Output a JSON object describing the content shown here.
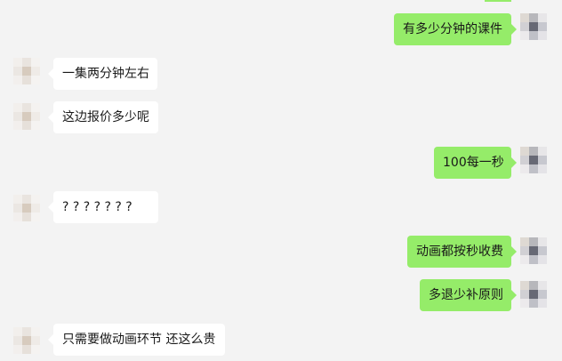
{
  "chat": {
    "messages": [
      {
        "side": "outgoing",
        "text": "有多少分钟的课件"
      },
      {
        "side": "incoming",
        "text": "一集两分钟左右"
      },
      {
        "side": "incoming",
        "text": "这边报价多少呢"
      },
      {
        "side": "outgoing",
        "text": "100每一秒"
      },
      {
        "side": "incoming",
        "text": "? ? ? ? ? ? ?"
      },
      {
        "side": "outgoing",
        "text": "动画都按秒收费"
      },
      {
        "side": "outgoing",
        "text": "多退少补原则"
      },
      {
        "side": "incoming",
        "text": "只需要做动画环节 还这么贵"
      }
    ]
  },
  "colors": {
    "background": "#f3f3f3",
    "incoming_bubble": "#ffffff",
    "outgoing_bubble": "#95ec69",
    "text": "#191919"
  },
  "icons": {
    "incoming_avatar": "contact-avatar-pixelated",
    "outgoing_avatar": "self-avatar-pixelated"
  }
}
